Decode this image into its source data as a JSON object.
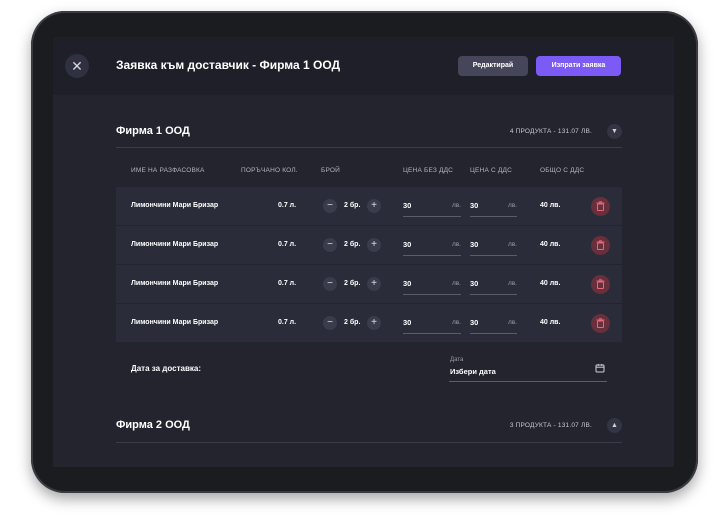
{
  "header": {
    "title": "Заявка към доставчик - Фирма 1 ООД",
    "edit_label": "Редактирай",
    "send_label": "Изпрати заявка"
  },
  "colors": {
    "accent": "#7b5af5",
    "background": "#23242e",
    "row": "#2b2c39",
    "danger": "#6a2f3c"
  },
  "sections": [
    {
      "title": "Фирма 1 ООД",
      "summary": "4 ПРОДУКТА - 131.07 ЛВ.",
      "expanded": true,
      "columns": [
        "ИМЕ НА РАЗФАСОВКА",
        "ПОРЪЧАНО КОЛ.",
        "БРОЙ",
        "ЦЕНА БЕЗ ДДС",
        "ЦЕНА С ДДС",
        "ОБЩО С ДДС"
      ],
      "rows": [
        {
          "name": "Лимончини Мари Бризар",
          "ordered": "0.7 л.",
          "qty": "2 бр.",
          "price_no_vat": "30",
          "price_vat": "30",
          "unit": "лв.",
          "total": "40 лв."
        },
        {
          "name": "Лимончини Мари Бризар",
          "ordered": "0.7 л.",
          "qty": "2 бр.",
          "price_no_vat": "30",
          "price_vat": "30",
          "unit": "лв.",
          "total": "40 лв."
        },
        {
          "name": "Лимончини Мари Бризар",
          "ordered": "0.7 л.",
          "qty": "2 бр.",
          "price_no_vat": "30",
          "price_vat": "30",
          "unit": "лв.",
          "total": "40 лв."
        },
        {
          "name": "Лимончини Мари Бризар",
          "ordered": "0.7 л.",
          "qty": "2 бр.",
          "price_no_vat": "30",
          "price_vat": "30",
          "unit": "лв.",
          "total": "40 лв."
        }
      ],
      "delivery_label": "Дата за доставка:",
      "date_caption": "Дата",
      "date_placeholder": "Избери дата"
    },
    {
      "title": "Фирма 2 ООД",
      "summary": "3 ПРОДУКТА - 131.07 ЛВ.",
      "expanded": false
    }
  ],
  "icons": {
    "close": "close-icon",
    "chevron_down": "chevron-down-icon",
    "chevron_up": "chevron-up-icon",
    "minus": "minus-icon",
    "plus": "plus-icon",
    "trash": "trash-icon",
    "calendar": "calendar-icon"
  }
}
